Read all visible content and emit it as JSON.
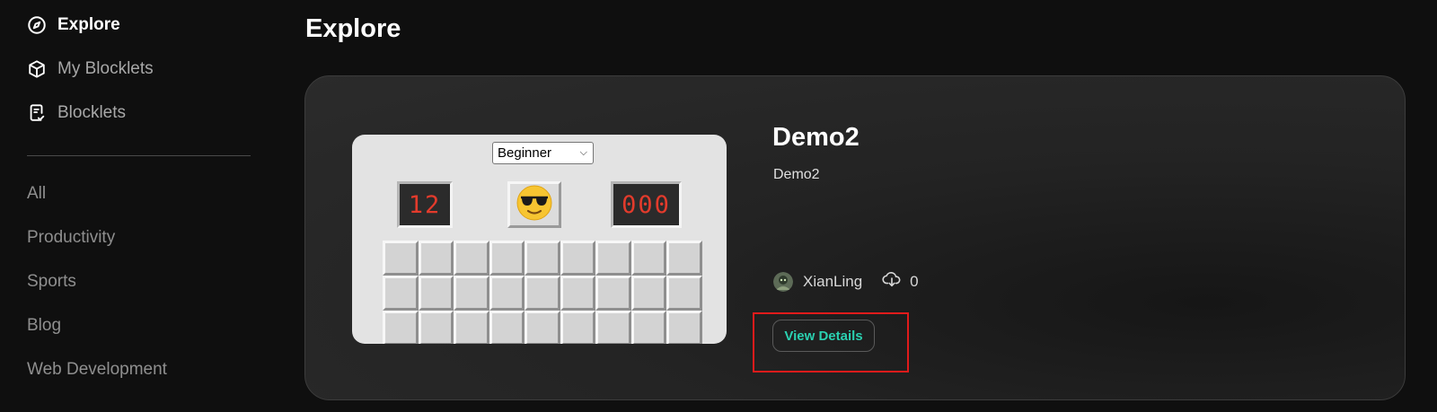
{
  "sidebar": {
    "nav": [
      {
        "label": "Explore",
        "icon": "compass-icon",
        "active": true
      },
      {
        "label": "My Blocklets",
        "icon": "cube-icon",
        "active": false
      },
      {
        "label": "Blocklets",
        "icon": "document-check-icon",
        "active": false
      }
    ],
    "categories": [
      "All",
      "Productivity",
      "Sports",
      "Blog",
      "Web Development"
    ]
  },
  "main": {
    "title": "Explore",
    "card": {
      "title": "Demo2",
      "description": "Demo2",
      "author": "XianLing",
      "downloads": "0",
      "button_label": "View Details",
      "preview": {
        "level": "Beginner",
        "mines_left": "12",
        "timer": "000",
        "face": "😎",
        "grid_columns": 9,
        "grid_rows_visible": 3
      }
    }
  },
  "colors": {
    "accent": "#2ad0b0",
    "background": "#0f0f0f",
    "highlight": "#e01b1b",
    "counter_digits": "#e33b2c"
  }
}
